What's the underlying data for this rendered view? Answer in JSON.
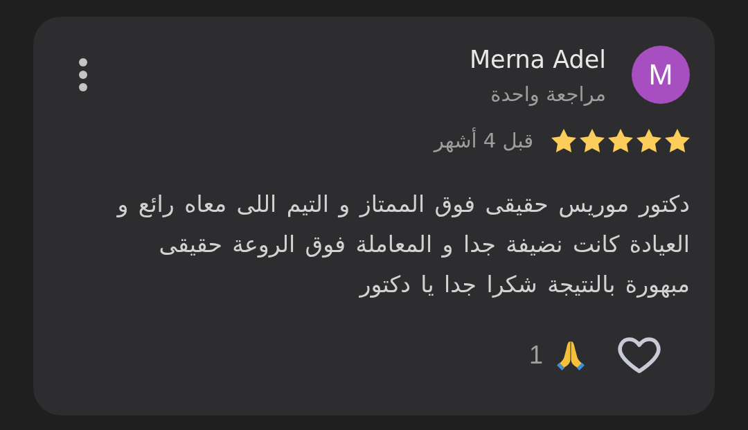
{
  "review": {
    "author": {
      "initial": "M",
      "name": "Merna Adel",
      "review_count": "مراجعة واحدة"
    },
    "stars": 5,
    "time": "قبل 4 أشهر",
    "text": "دكتور موريس حقيقى فوق الممتاز و التيم اللى معاه رائع و العيادة كانت نضيفة جدا و المعاملة فوق الروعة حقيقى مبهورة بالنتيجة شكرا جدا يا دكتور",
    "liked": false,
    "reaction": {
      "count": "1"
    }
  }
}
